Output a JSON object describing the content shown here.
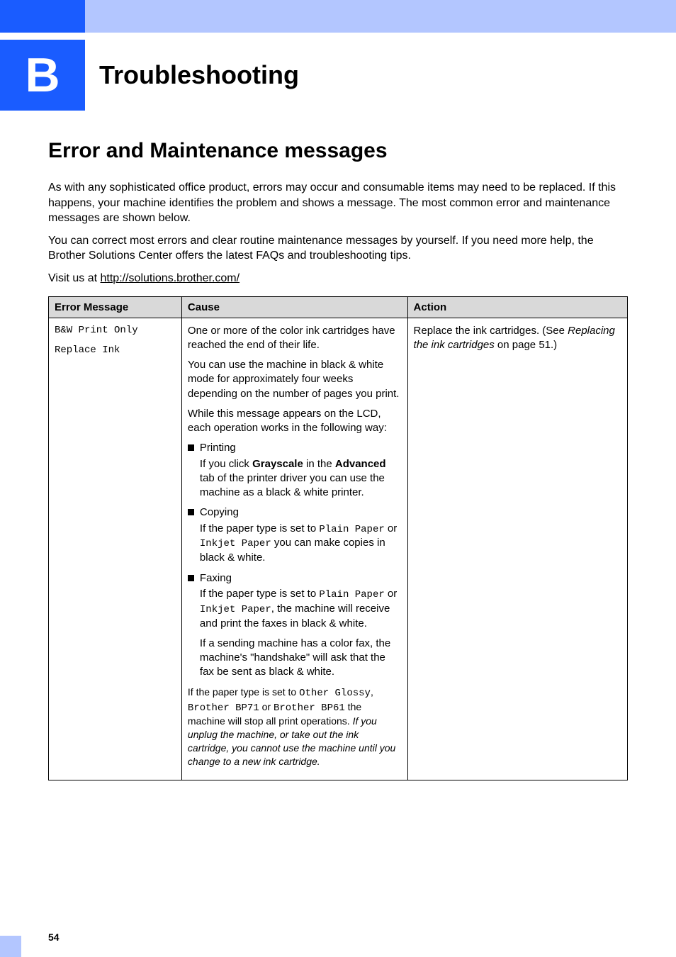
{
  "chapter": {
    "letter": "B",
    "title": "Troubleshooting"
  },
  "section": {
    "title": "Error and Maintenance messages"
  },
  "intro": {
    "p1": "As with any sophisticated office product, errors may occur and consumable items may need to be replaced. If this happens, your machine identifies the problem and shows a message. The most common error and maintenance messages are shown below.",
    "p2": "You can correct most errors and clear routine maintenance messages by yourself. If you need more help, the Brother Solutions Center offers the latest FAQs and troubleshooting tips.",
    "p3_prefix": "Visit us at ",
    "p3_link": "http://solutions.brother.com/"
  },
  "table": {
    "headers": {
      "error": "Error Message",
      "cause": "Cause",
      "action": "Action"
    },
    "row1": {
      "err_line1": "B&W Print Only",
      "err_line2": "Replace Ink",
      "cause": {
        "p1": "One or more of the color ink cartridges have reached the end of their life.",
        "p2": "You can use the machine in black & white mode for approximately four weeks depending on the number of pages you print.",
        "p3": "While this message appears on the LCD, each operation works in the following way:",
        "b1_label": "Printing",
        "b1_sub_a": "If you click ",
        "b1_sub_b": "Grayscale",
        "b1_sub_c": " in the ",
        "b1_sub_d": "Advanced",
        "b1_sub_e": " tab of the printer driver you can use the machine as a black & white printer.",
        "b2_label": "Copying",
        "b2_sub_a": "If the paper type is set to ",
        "b2_sub_b": "Plain Paper",
        "b2_sub_c": " or ",
        "b2_sub_d": "Inkjet Paper",
        "b2_sub_e": " you can make copies in black & white.",
        "b3_label": "Faxing",
        "b3_sub_a": "If the paper type is set to ",
        "b3_sub_b": "Plain Paper",
        "b3_sub_c": " or ",
        "b3_sub_d": "Inkjet Paper",
        "b3_sub_e": ", the machine will receive and print the faxes in black & white.",
        "b3_sub2": "If a sending machine has a color fax, the machine's \"handshake\" will ask that the fax be sent as black & white.",
        "footer_a": "If the paper type is set to ",
        "footer_b": "Other Glossy",
        "footer_c": ", ",
        "footer_d": "Brother BP71",
        "footer_e": " or ",
        "footer_f": "Brother BP61",
        "footer_g": " the machine will stop all print operations. ",
        "footer_h": "If you unplug the machine, or take out the ink cartridge, you cannot use the machine until you change to a new ink cartridge."
      },
      "action_a": "Replace the ink cartridges. (See ",
      "action_b": "Replacing the ink cartridges",
      "action_c": " on page 51.)"
    }
  },
  "page_number": "54"
}
